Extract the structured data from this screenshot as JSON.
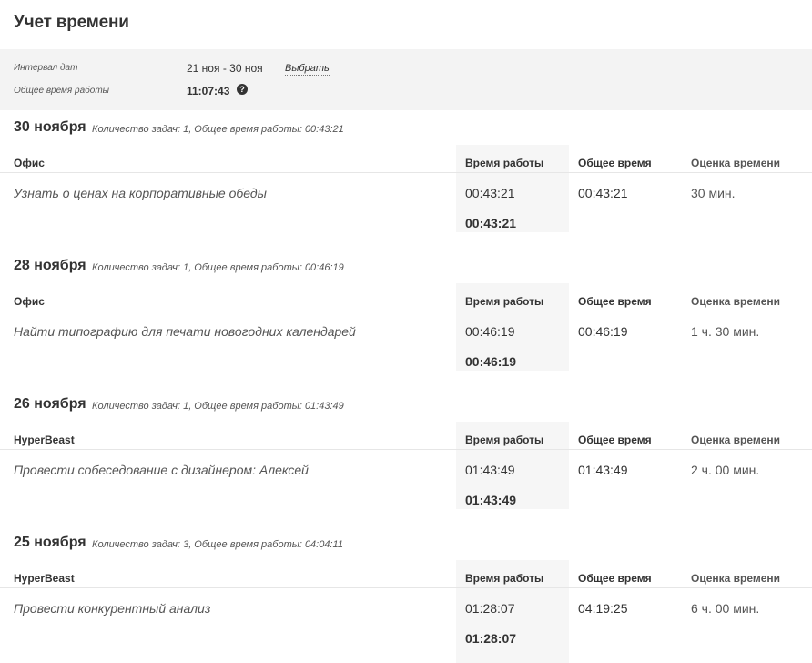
{
  "page": {
    "title": "Учет времени"
  },
  "filter": {
    "interval_label": "Интервал дат",
    "interval_value": "21 ноя - 30 ноя",
    "choose_label": "Выбрать",
    "total_label": "Общее время работы",
    "total_value": "11:07:43",
    "help_glyph": "?"
  },
  "columns": {
    "work_time": "Время работы",
    "total_time": "Общее время",
    "estimate": "Оценка времени"
  },
  "days": [
    {
      "date": "30 ноября",
      "summary": "Количество задач: 1, Общее время работы: 00:43:21",
      "project": "Офис",
      "task": "Узнать о ценах на корпоративные обеды",
      "work_time": "00:43:21",
      "total_time": "00:43:21",
      "estimate": "30 мин.",
      "subtotal": "00:43:21"
    },
    {
      "date": "28 ноября",
      "summary": "Количество задач: 1, Общее время работы: 00:46:19",
      "project": "Офис",
      "task": "Найти типографию для печати новогодних календарей",
      "work_time": "00:46:19",
      "total_time": "00:46:19",
      "estimate": "1 ч. 30 мин.",
      "subtotal": "00:46:19"
    },
    {
      "date": "26 ноября",
      "summary": "Количество задач: 1, Общее время работы: 01:43:49",
      "project": "HyperBeast",
      "task": "Провести собеседование с дизайнером: Алексей",
      "work_time": "01:43:49",
      "total_time": "01:43:49",
      "estimate": "2 ч. 00 мин.",
      "subtotal": "01:43:49"
    },
    {
      "date": "25 ноября",
      "summary": "Количество задач: 3, Общее время работы: 04:04:11",
      "project": "HyperBeast",
      "task": "Провести конкурентный анализ",
      "work_time": "01:28:07",
      "total_time": "04:19:25",
      "estimate": "6 ч. 00 мин.",
      "subtotal": "01:28:07"
    }
  ]
}
